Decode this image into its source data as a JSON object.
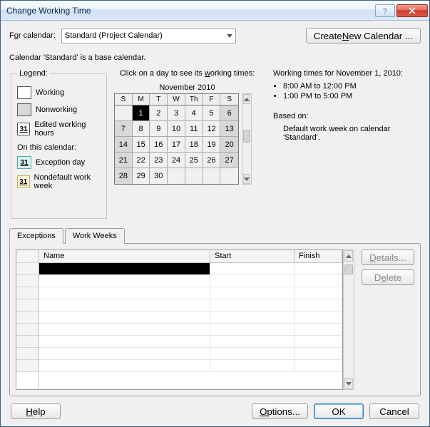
{
  "window": {
    "title": "Change Working Time"
  },
  "top": {
    "for_calendar_label": "For calendar:",
    "calendar_name": "Standard (Project Calendar)",
    "create_new_label_pre": "Create ",
    "create_new_label_u": "N",
    "create_new_label_post": "ew Calendar ..."
  },
  "base_note": "Calendar 'Standard' is a base calendar.",
  "legend": {
    "title": "Legend:",
    "working": "Working",
    "nonworking": "Nonworking",
    "edited_num": "31",
    "edited": "Edited working hours",
    "on_this": "On this calendar:",
    "exception_num": "31",
    "exception": "Exception day",
    "nondefault_num": "31",
    "nondefault": "Nondefault work week"
  },
  "calendar": {
    "click_hint_pre": "Click on a day to see its ",
    "click_hint_u": "w",
    "click_hint_post": "orking times:",
    "month_label": "November 2010",
    "dow": [
      "S",
      "M",
      "T",
      "W",
      "Th",
      "F",
      "S"
    ],
    "weeks": [
      [
        {
          "n": "",
          "cls": ""
        },
        {
          "n": "1",
          "cls": "sel"
        },
        {
          "n": "2",
          "cls": ""
        },
        {
          "n": "3",
          "cls": ""
        },
        {
          "n": "4",
          "cls": ""
        },
        {
          "n": "5",
          "cls": ""
        },
        {
          "n": "6",
          "cls": "nw"
        }
      ],
      [
        {
          "n": "7",
          "cls": "nw"
        },
        {
          "n": "8",
          "cls": ""
        },
        {
          "n": "9",
          "cls": ""
        },
        {
          "n": "10",
          "cls": ""
        },
        {
          "n": "11",
          "cls": ""
        },
        {
          "n": "12",
          "cls": ""
        },
        {
          "n": "13",
          "cls": "nw"
        }
      ],
      [
        {
          "n": "14",
          "cls": "nw"
        },
        {
          "n": "15",
          "cls": ""
        },
        {
          "n": "16",
          "cls": ""
        },
        {
          "n": "17",
          "cls": ""
        },
        {
          "n": "18",
          "cls": ""
        },
        {
          "n": "19",
          "cls": ""
        },
        {
          "n": "20",
          "cls": "nw"
        }
      ],
      [
        {
          "n": "21",
          "cls": "nw"
        },
        {
          "n": "22",
          "cls": ""
        },
        {
          "n": "23",
          "cls": ""
        },
        {
          "n": "24",
          "cls": ""
        },
        {
          "n": "25",
          "cls": ""
        },
        {
          "n": "26",
          "cls": ""
        },
        {
          "n": "27",
          "cls": "nw"
        }
      ],
      [
        {
          "n": "28",
          "cls": "nw"
        },
        {
          "n": "29",
          "cls": ""
        },
        {
          "n": "30",
          "cls": ""
        },
        {
          "n": "",
          "cls": ""
        },
        {
          "n": "",
          "cls": ""
        },
        {
          "n": "",
          "cls": ""
        },
        {
          "n": "",
          "cls": ""
        }
      ]
    ]
  },
  "detail": {
    "heading": "Working times for November 1, 2010:",
    "times": [
      "8:00 AM to 12:00 PM",
      "1:00 PM to 5:00 PM"
    ],
    "based_on_label": "Based on:",
    "based_on_text": "Default work week on calendar 'Standard'."
  },
  "tabs": {
    "exceptions": "Exceptions",
    "work_weeks": "Work Weeks",
    "cols": {
      "name": "Name",
      "start": "Start",
      "finish": "Finish"
    },
    "details_btn_u": "D",
    "details_btn_post": "etails...",
    "delete_btn_pre": "D",
    "delete_btn_u": "e",
    "delete_btn_post": "lete"
  },
  "bottom": {
    "help_u": "H",
    "help_post": "elp",
    "options_u": "O",
    "options_post": "ptions...",
    "ok": "OK",
    "cancel": "Cancel"
  }
}
